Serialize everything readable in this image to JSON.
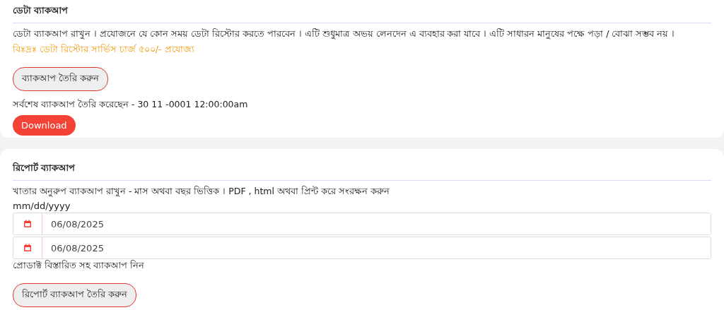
{
  "data_backup": {
    "title": "ডেটা ব্যাকআপ",
    "description": "ডেটা ব্যাকআপ রাখুন । প্রযোজনে যে কোন সময় ডেটা রিস্টোর করতে পারবেন । এটি শুধুমাত্র অভয় লেনদেন এ ব্যবহার করা যাবে । এটি সাধারন মানুষের পক্ষে পড়া / বোঝা সম্ভব নয় ।",
    "note": "বিঃদ্রঃ ডেটা রিস্টোর সার্ভিস চার্জ ৫০০/- প্রযোজ্য",
    "create_button": "ব্যাকআপ তৈরি করুন",
    "last_backup": "সর্বশেষ ব্যাকআপ তৈরি করেছেন - 30 11 -0001 12:00:00am",
    "download_button": "Download"
  },
  "report_backup": {
    "title": "রিপোর্ট ব্যাকআপ",
    "description": "খাতার অনুরুপ ব্যাকআপ রাখুন - মাস অথবা বছর ভিত্তিক । PDF , html অথবা প্রিন্ট করে সংরক্ষন করুন",
    "date_format": "mm/dd/yyyy",
    "date_fields": [
      {
        "value": "06/08/2025"
      },
      {
        "value": "06/08/2025"
      }
    ],
    "product_note": "প্রোডাক্ট বিস্তারিত সহ ব্যাকআপ নিন",
    "create_button": "রিপোর্ট ব্যাকআপ তৈরি করুন"
  }
}
